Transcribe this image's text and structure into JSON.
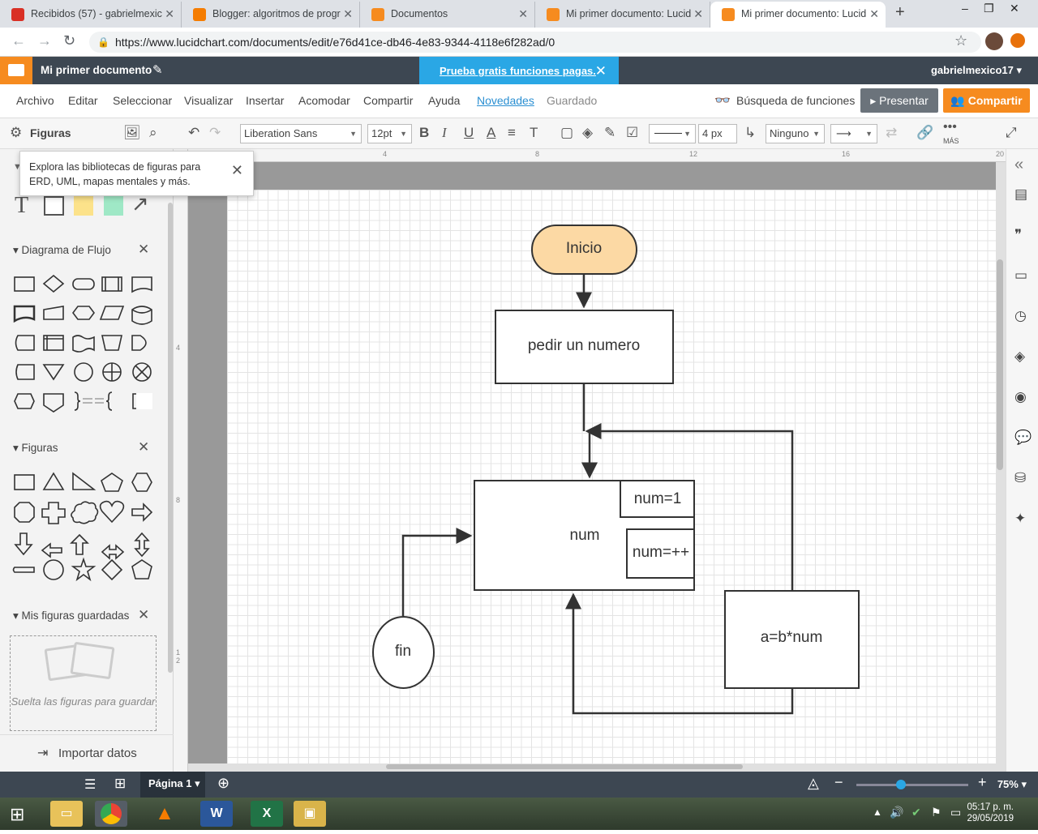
{
  "browser": {
    "tabs": [
      {
        "label": "Recibidos (57) - gabrielmexic",
        "favicon_color": "#d93025"
      },
      {
        "label": "Blogger: algoritmos de progr",
        "favicon_color": "#f57c00"
      },
      {
        "label": "Documentos",
        "favicon_color": "#f68b1f"
      },
      {
        "label": "Mi primer documento: Lucid",
        "favicon_color": "#f68b1f"
      },
      {
        "label": "Mi primer documento: Lucid",
        "favicon_color": "#f68b1f"
      }
    ],
    "new_tab": "+",
    "url": "https://www.lucidchart.com/documents/edit/e76d41ce-db46-4e83-9344-4118e6f282ad/0"
  },
  "app": {
    "doc_title": "Mi primer documento",
    "promo": "Prueba gratis funciones pagas.",
    "user": "gabrielmexico17",
    "menu": [
      "Archivo",
      "Editar",
      "Seleccionar",
      "Visualizar",
      "Insertar",
      "Acomodar",
      "Compartir",
      "Ayuda"
    ],
    "novedades": "Novedades",
    "guardado": "Guardado",
    "feature_search": "Búsqueda de funciones",
    "present": "Presentar",
    "share": "Compartir",
    "accent": "#f68b1f"
  },
  "toolbar": {
    "figuras": "Figuras",
    "font": "Liberation Sans",
    "font_size": "12pt",
    "line_width": "4 px",
    "endpoint": "Ninguno",
    "more": "MÁS"
  },
  "ruler": {
    "h_ticks": [
      "4",
      "8",
      "12",
      "16",
      "20"
    ],
    "v_ticks": [
      "4",
      "8",
      "1 2"
    ]
  },
  "leftpanel": {
    "tooltip": "Explora las bibliotecas de figuras para ERD, UML, mapas mentales y más.",
    "section_flow": "Diagrama de Flujo",
    "section_shapes": "Figuras",
    "section_saved": "Mis figuras guardadas",
    "dropzone": "Suelta las figuras para guardar",
    "import": "Importar datos"
  },
  "diagram": {
    "start": "Inicio",
    "process1": "pedir un numero",
    "loop": "num",
    "loop_init": "num=1",
    "loop_inc": "num=++",
    "calc": "a=b*num",
    "end": "fin"
  },
  "bottombar": {
    "page": "Página 1",
    "zoom": "75%"
  },
  "taskbar": {
    "time": "05:17 p. m.",
    "date": "29/05/2019"
  }
}
